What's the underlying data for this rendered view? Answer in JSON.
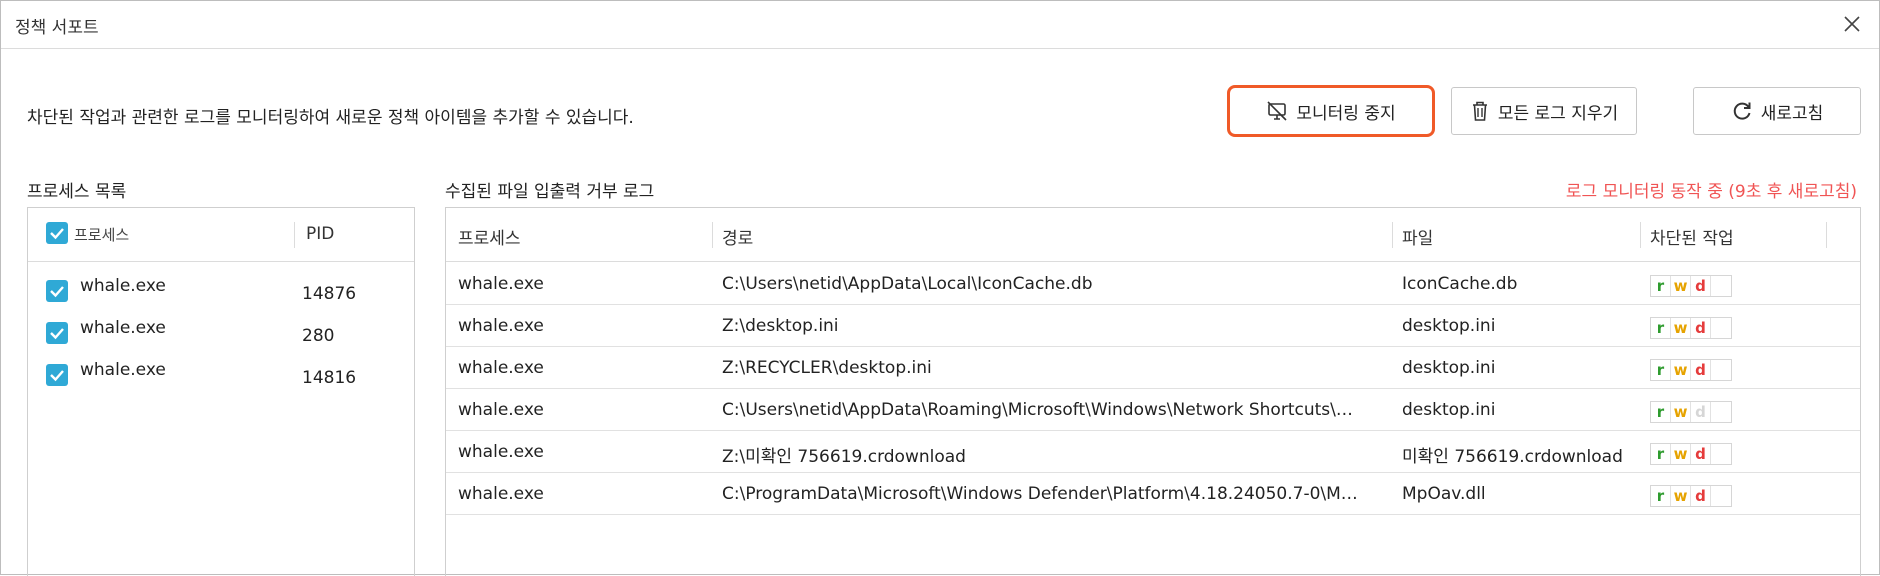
{
  "window": {
    "title": "정책 서포트"
  },
  "description": "차단된 작업과 관련한 로그를 모니터링하여 새로운 정책 아이템을 추가할 수 있습니다.",
  "toolbar": {
    "stop_monitoring": "모니터링 중지",
    "clear_logs": "모든 로그 지우기",
    "refresh": "새로고침"
  },
  "process_list": {
    "label": "프로세스 목록",
    "header": {
      "process": "프로세스",
      "pid": "PID"
    },
    "rows": [
      {
        "name": "whale.exe",
        "pid": "14876",
        "checked": true
      },
      {
        "name": "whale.exe",
        "pid": "280",
        "checked": true
      },
      {
        "name": "whale.exe",
        "pid": "14816",
        "checked": true
      }
    ]
  },
  "log": {
    "label": "수집된 파일 입출력 거부 로그",
    "status": "로그 모니터링 동작 중 (9초 후 새로고침)",
    "header": {
      "process": "프로세스",
      "path": "경로",
      "file": "파일",
      "blocked": "차단된 작업"
    },
    "rows": [
      {
        "process": "whale.exe",
        "path": "C:\\Users\\netid\\AppData\\Local\\IconCache.db",
        "file": "IconCache.db",
        "ops": {
          "r": "r",
          "w": "w",
          "d": "d",
          "d_active": true
        }
      },
      {
        "process": "whale.exe",
        "path": "Z:\\desktop.ini",
        "file": "desktop.ini",
        "ops": {
          "r": "r",
          "w": "w",
          "d": "d",
          "d_active": true
        }
      },
      {
        "process": "whale.exe",
        "path": "Z:\\RECYCLER\\desktop.ini",
        "file": "desktop.ini",
        "ops": {
          "r": "r",
          "w": "w",
          "d": "d",
          "d_active": true
        }
      },
      {
        "process": "whale.exe",
        "path": "C:\\Users\\netid\\AppData\\Roaming\\Microsoft\\Windows\\Network Shortcuts\\…",
        "file": "desktop.ini",
        "ops": {
          "r": "r",
          "w": "w",
          "d": "d",
          "d_active": false
        }
      },
      {
        "process": "whale.exe",
        "path": "Z:\\미확인 756619.crdownload",
        "file": "미확인 756619.crdownload",
        "ops": {
          "r": "r",
          "w": "w",
          "d": "d",
          "d_active": true
        }
      },
      {
        "process": "whale.exe",
        "path": "C:\\ProgramData\\Microsoft\\Windows Defender\\Platform\\4.18.24050.7-0\\M…",
        "file": "MpOav.dll",
        "ops": {
          "r": "r",
          "w": "w",
          "d": "d",
          "d_active": true
        }
      }
    ]
  },
  "colors": {
    "accent_orange": "#f05a28",
    "status_red": "#f05454",
    "checkbox_blue": "#2fa9d6",
    "op_read": "#2e9b2e",
    "op_write": "#e6a300",
    "op_delete": "#e53b3b"
  },
  "icons": {
    "stop_monitoring": "monitor-off-icon",
    "clear_logs": "trash-icon",
    "refresh": "refresh-icon",
    "close": "close-icon",
    "checkbox": "checkmark-icon"
  }
}
